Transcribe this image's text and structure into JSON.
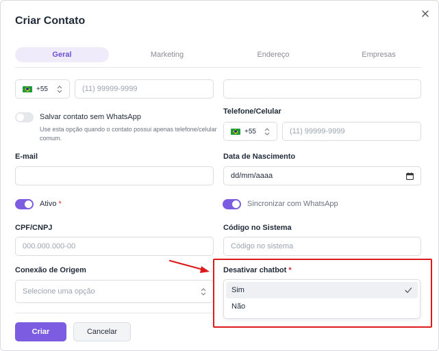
{
  "dialog": {
    "title": "Criar Contato"
  },
  "tabs": [
    {
      "label": "Geral",
      "active": true
    },
    {
      "label": "Marketing",
      "active": false
    },
    {
      "label": "Endereço",
      "active": false
    },
    {
      "label": "Empresas",
      "active": false
    }
  ],
  "phone_primary": {
    "country_code": "+55",
    "placeholder": "(11) 99999-9999"
  },
  "top_right_input": {
    "value": ""
  },
  "save_without_whatsapp": {
    "label": "Salvar contato sem WhatsApp",
    "helper": "Use esta opção quando o contato possui apenas telefone/celular comum.",
    "enabled": false
  },
  "phone_secondary": {
    "label": "Telefone/Celular",
    "country_code": "+55",
    "placeholder": "(11) 99999-9999"
  },
  "email": {
    "label": "E-mail",
    "value": ""
  },
  "birth_date": {
    "label": "Data de Nascimento",
    "placeholder": "dd/mm/aaaa"
  },
  "active_toggle": {
    "label": "Ativo",
    "required_mark": "*",
    "enabled": true
  },
  "sync_whatsapp": {
    "label": "Sincronizar com WhatsApp",
    "enabled": true
  },
  "cpf": {
    "label": "CPF/CNPJ",
    "placeholder": "000.000.000-00"
  },
  "system_code": {
    "label": "Código no Sistema",
    "placeholder": "Código no sistema"
  },
  "origin_connection": {
    "label": "Conexão de Origem",
    "placeholder": "Selecione uma opção"
  },
  "disable_chatbot": {
    "label": "Desativar chatbot",
    "required_mark": "*",
    "options": [
      "Sim",
      "Não"
    ],
    "selected": "Sim"
  },
  "actions": {
    "create_label": "Criar",
    "cancel_label": "Cancelar"
  },
  "annotation": {
    "highlight_color": "#dc1a1a"
  },
  "colors": {
    "accent": "#7c5ce0",
    "tab_active_bg": "#efebfb",
    "required": "#dc2626"
  }
}
